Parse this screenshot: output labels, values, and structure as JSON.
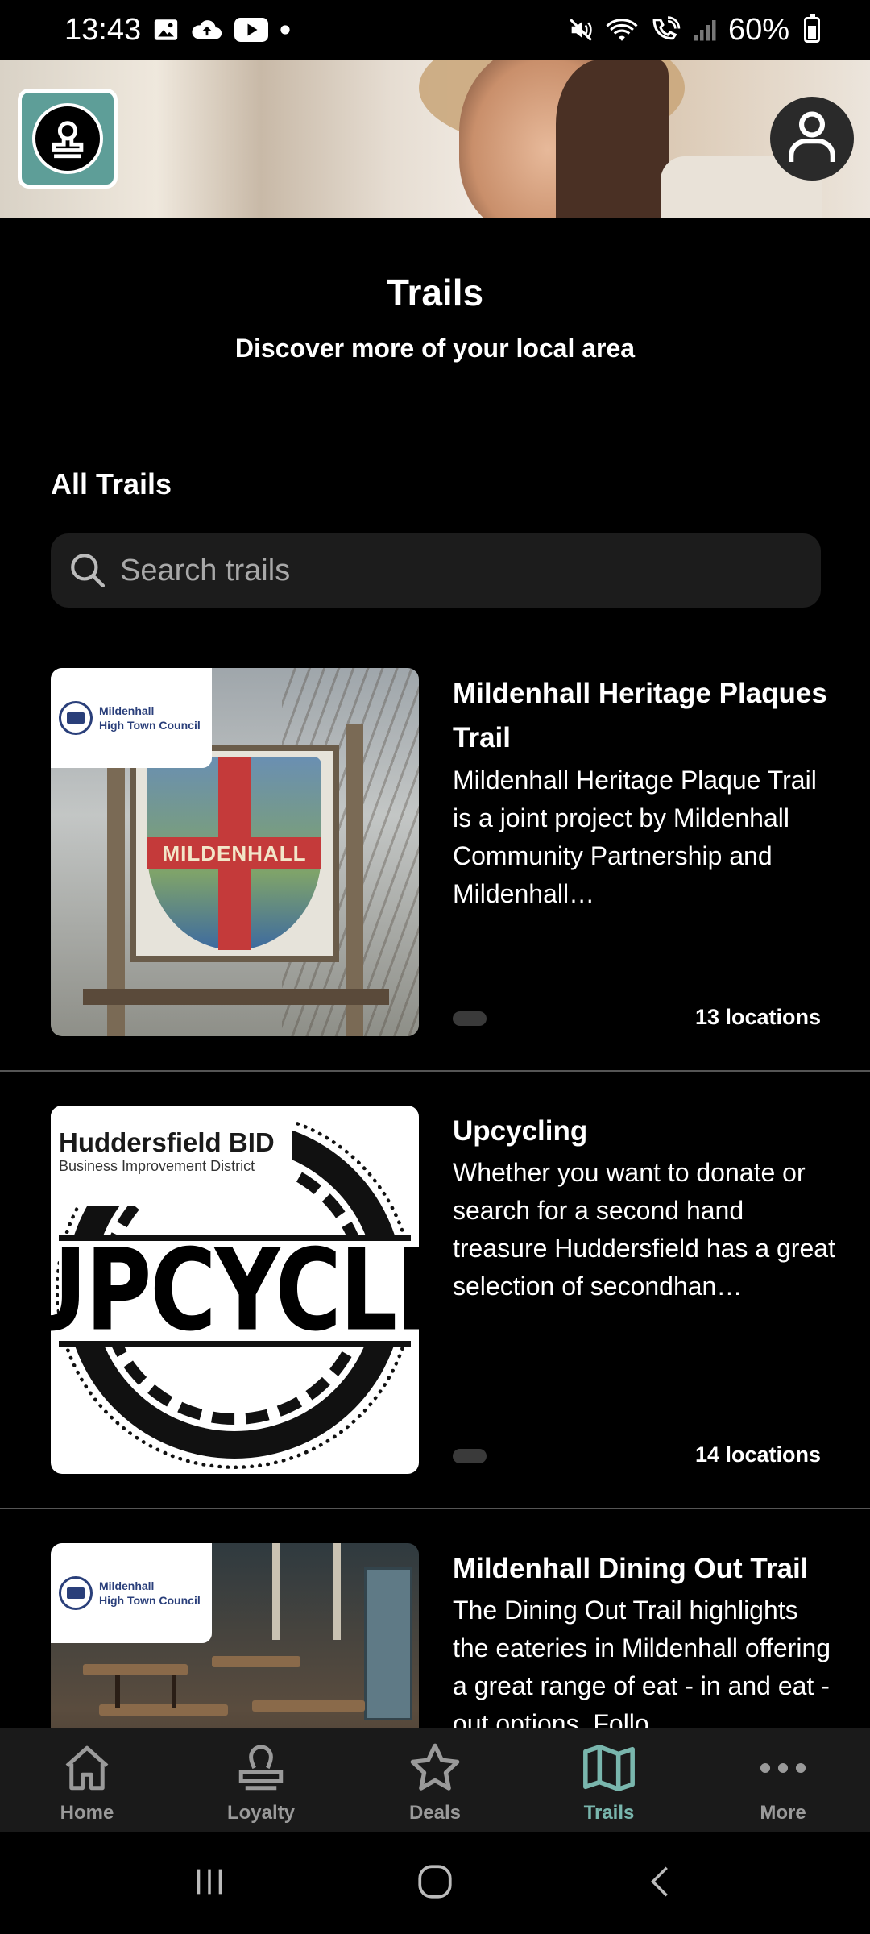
{
  "status_bar": {
    "time": "13:43",
    "battery": "60%",
    "battery_level": 0.6,
    "icons": [
      "gallery-icon",
      "cloud-upload-icon",
      "youtube-icon",
      "dot-icon",
      "mute-icon",
      "wifi-icon",
      "wifi-calling-icon",
      "signal-icon"
    ]
  },
  "header": {
    "title": "Trails",
    "subtitle": "Discover more of your local area"
  },
  "section": {
    "title": "All Trails"
  },
  "search": {
    "placeholder": "Search trails",
    "value": ""
  },
  "trails": [
    {
      "title": "Mildenhall Heritage Plaques Trail",
      "description": "Mildenhall Heritage Plaque Trail is a joint project by Mildenhall Community Partnership and Mildenhall…",
      "count": "13 locations",
      "image_tag": [
        "Mildenhall",
        "High Town Council"
      ],
      "sign_text": "MILDENHALL"
    },
    {
      "title": "Upcycling",
      "description": "Whether you want to donate or search for a second hand treasure Huddersfield has a great selection of secondhan…",
      "count": "14 locations",
      "image_tag": [
        "Huddersfield BID",
        "Business Improvement District"
      ],
      "sign_text": "UPCYCLE"
    },
    {
      "title": "Mildenhall Dining Out Trail",
      "description": "The Dining Out Trail highlights the eateries in Mildenhall offering a great range of eat - in and eat - out options. Follo…",
      "count": "",
      "image_tag": [
        "Mildenhall",
        "High Town Council"
      ]
    }
  ],
  "bottom_nav": [
    {
      "label": "Home",
      "icon": "home-icon",
      "active": false
    },
    {
      "label": "Loyalty",
      "icon": "stamp-icon",
      "active": false
    },
    {
      "label": "Deals",
      "icon": "star-icon",
      "active": false
    },
    {
      "label": "Trails",
      "icon": "map-icon",
      "active": true
    },
    {
      "label": "More",
      "icon": "more-icon",
      "active": false
    }
  ],
  "colors": {
    "accent": "#79b6ad",
    "background": "#000000",
    "nav_background": "#1a1a1a",
    "search_background": "#1c1c1c",
    "logo_badge": "#5e9e98"
  }
}
